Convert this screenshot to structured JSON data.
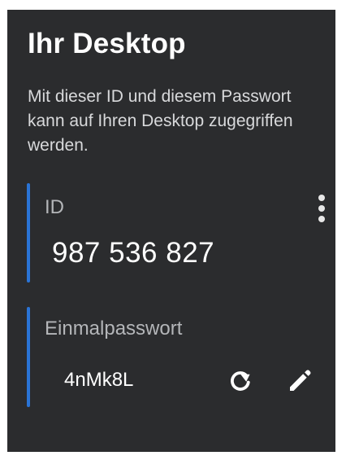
{
  "panel": {
    "title": "Ihr Desktop",
    "description": "Mit dieser ID und diesem Passwort kann auf Ihren Desktop zugegriffen werden.",
    "accent_color": "#2a74d6",
    "background_color": "#2b2c2e"
  },
  "id_section": {
    "label": "ID",
    "value": "987 536 827",
    "menu_icon": "more-vertical-icon"
  },
  "password_section": {
    "label": "Einmalpasswort",
    "value": "4nMk8L",
    "refresh_icon": "refresh-icon",
    "edit_icon": "pencil-icon"
  }
}
